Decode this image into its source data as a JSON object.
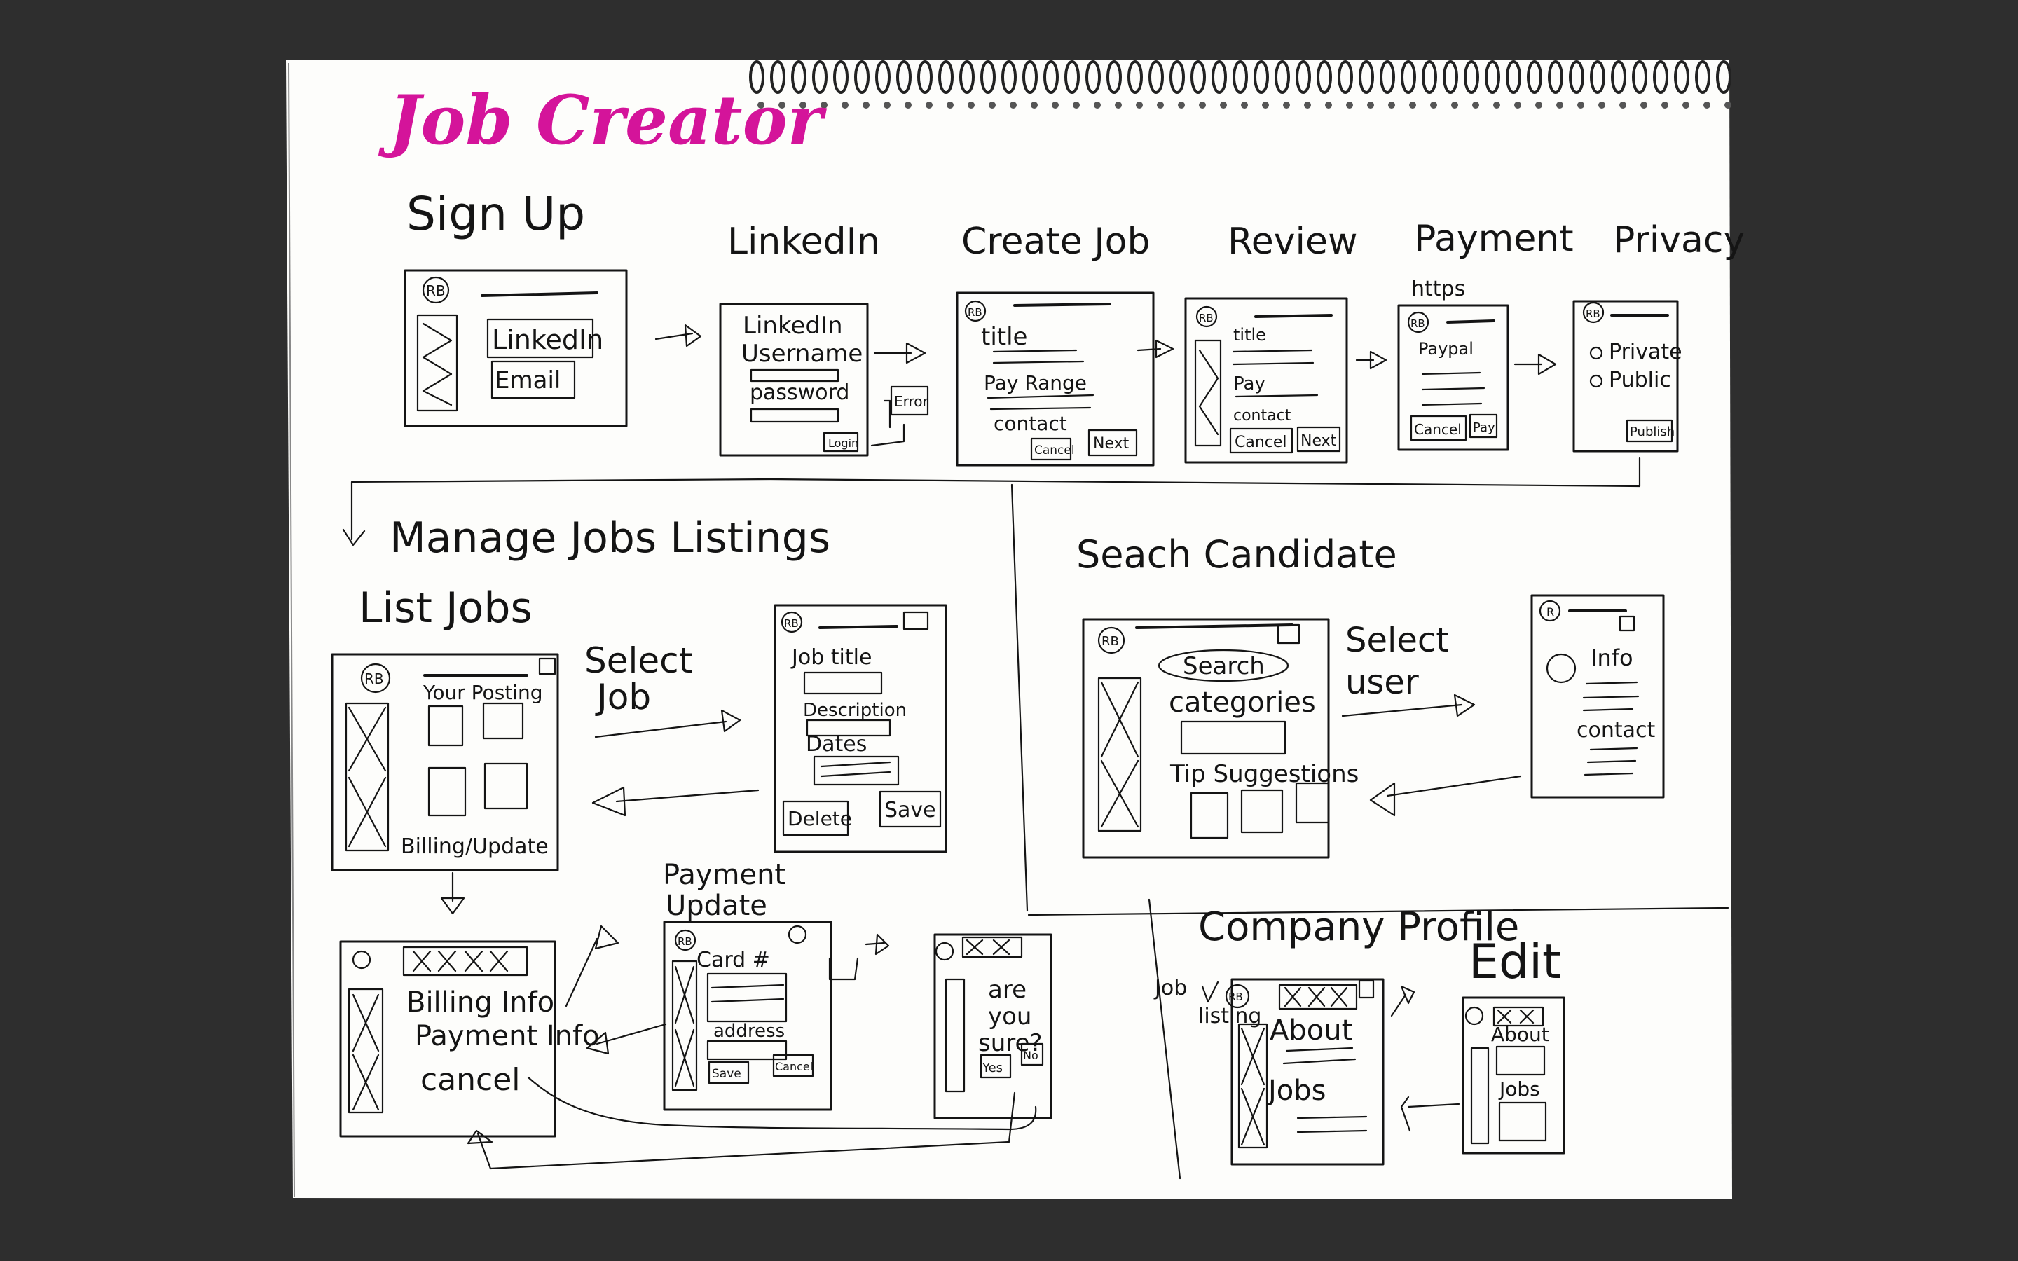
{
  "title": "Job Creator",
  "colors": {
    "title": "#d4149a",
    "background": "#2e2e2e",
    "paper": "#fdfdfb",
    "ink": "#141414"
  },
  "signup": {
    "heading": "Sign Up",
    "logo": "RB",
    "buttons": [
      "LinkedIn",
      "Email"
    ]
  },
  "linkedin": {
    "heading": "LinkedIn",
    "lines": [
      "LinkedIn",
      "Username",
      "password"
    ],
    "login_label": "Login",
    "error_label": "Error"
  },
  "create_job": {
    "heading": "Create Job",
    "logo": "RB",
    "fields": [
      "title",
      "Pay Range",
      "contact"
    ],
    "buttons": [
      "Cancel",
      "Next"
    ]
  },
  "review": {
    "heading": "Review",
    "logo": "RB",
    "fields": [
      "title",
      "Pay",
      "contact"
    ],
    "buttons": [
      "Cancel",
      "Next"
    ]
  },
  "payment": {
    "heading": "Payment",
    "note": "https",
    "logo": "RB",
    "field": "Paypal",
    "buttons": [
      "Cancel",
      "Pay"
    ]
  },
  "privacy": {
    "heading": "Privacy",
    "logo": "RB",
    "options": [
      "Private",
      "Public"
    ],
    "button": "Publish"
  },
  "manage": {
    "heading": "Manage Jobs Listings",
    "subheading": "List Jobs",
    "list_screen": {
      "logo": "RB",
      "header": "Your Posting",
      "footer": "Billing/Update"
    },
    "select_label": [
      "Select",
      "Job"
    ],
    "detail_screen": {
      "logo": "RB",
      "fields": [
        "Job title",
        "Description",
        "Dates"
      ],
      "buttons": [
        "Delete",
        "Save"
      ]
    },
    "billing_screen": {
      "lines": [
        "Billing Info",
        "Payment Info",
        "cancel"
      ]
    },
    "payment_update": {
      "heading": [
        "Payment",
        "Update"
      ],
      "logo": "RB",
      "fields": [
        "Card #",
        "address"
      ],
      "buttons": [
        "Save",
        "Cancel"
      ]
    },
    "confirm_screen": {
      "lines": [
        "are",
        "you",
        "sure?"
      ],
      "buttons": [
        "Yes",
        "No"
      ]
    }
  },
  "search": {
    "heading": "Seach Candidate",
    "logo": "RB",
    "search_label": "Search",
    "categories_label": "categories",
    "tip_label": "Tip Suggestions",
    "select_label": [
      "Select",
      "user"
    ],
    "profile_screen": {
      "logo": "R",
      "info_label": "Info",
      "contact_label": "contact"
    }
  },
  "company": {
    "heading": "Company Profile",
    "edit_label": "Edit",
    "job_listing_label": [
      "Job",
      "listing"
    ],
    "profile_screen": {
      "logo": "RB",
      "lines": [
        "About",
        "Jobs"
      ]
    },
    "edit_screen": {
      "lines": [
        "About",
        "Jobs"
      ]
    }
  }
}
